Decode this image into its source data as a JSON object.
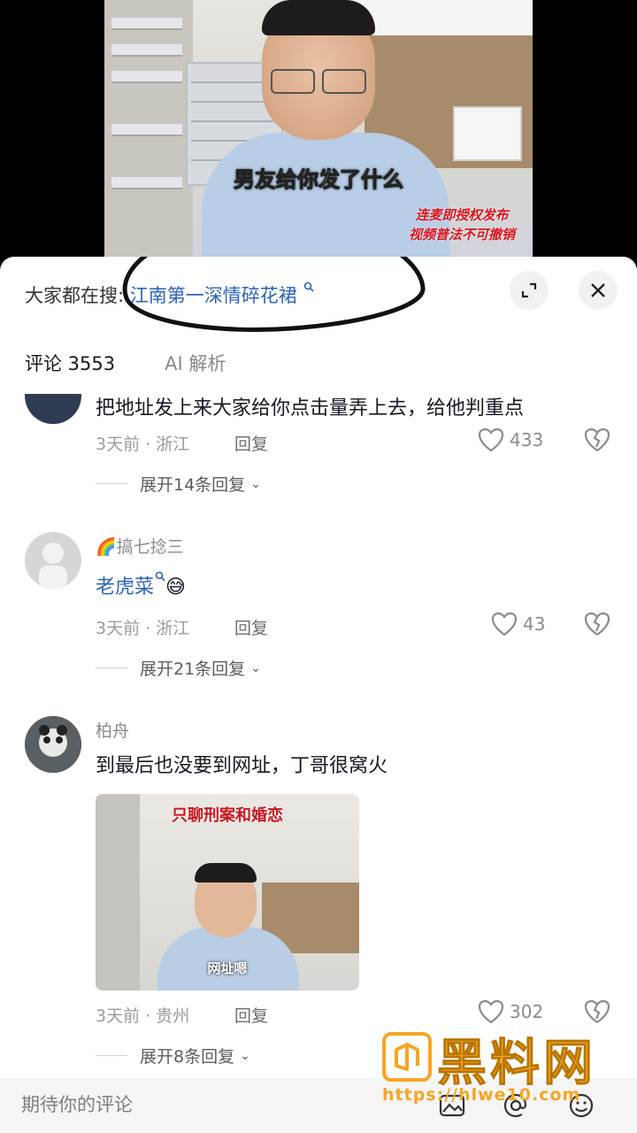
{
  "video": {
    "subtitle": "男友给你发了什么",
    "watermark_line1": "连麦即授权发布",
    "watermark_line2": "视频普法不可撤销"
  },
  "panel": {
    "search_prefix": "大家都在搜:",
    "search_term": "江南第一深情碎花裙",
    "tabs": [
      {
        "label": "评论 3553",
        "active": true
      },
      {
        "label": "AI 解析",
        "active": false
      }
    ]
  },
  "comments": [
    {
      "username": "",
      "text": "把地址发上来大家给你点击量弄上去，给他判重点",
      "meta": "3天前 · 浙江",
      "reply": "回复",
      "likes": "433",
      "expand": "展开14条回复"
    },
    {
      "username": "🌈搞七捻三",
      "text_term": "老虎菜",
      "text_suffix": "😅",
      "meta": "3天前 · 浙江",
      "reply": "回复",
      "likes": "43",
      "expand": "展开21条回复"
    },
    {
      "username": "柏舟",
      "text": "到最后也没要到网址，丁哥很窝火",
      "image_caption_top": "只聊刑案和婚恋",
      "image_caption_bottom": "网址嗯",
      "meta": "3天前 · 贵州",
      "reply": "回复",
      "likes": "302",
      "expand": "展开8条回复"
    }
  ],
  "bottom_bar": {
    "placeholder": "期待你的评论",
    "icons": [
      "image-icon",
      "at-icon",
      "emoji-icon"
    ]
  },
  "site_watermark": {
    "name": "黑料网",
    "url": "https://hlwe10.com"
  },
  "colors": {
    "link": "#2b63b8",
    "accent": "#f5a623",
    "text": "#161823",
    "muted": "#9a9ba0"
  }
}
